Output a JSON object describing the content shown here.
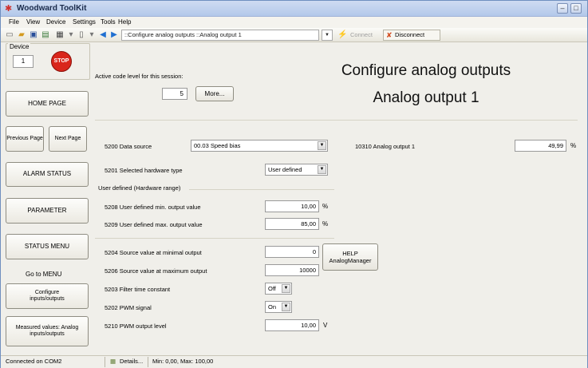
{
  "window": {
    "title": "Woodward ToolKit"
  },
  "menubar": {
    "items": [
      "File",
      "View",
      "Device",
      "Settings",
      "Tools",
      "Help"
    ]
  },
  "toolbar": {
    "page_field": "::Configure analog outputs ::Analog output 1",
    "connect_label": "Connect",
    "disconnect_label": "Disconnect"
  },
  "sidebar": {
    "device_label": "Device",
    "device_number": "1",
    "stop_label": "STOP",
    "home_page": "HOME PAGE",
    "previous_page": "Previous Page",
    "next_page": "Next Page",
    "alarm_status": "ALARM STATUS",
    "parameter": "PARAMETER",
    "status_menu": "STATUS MENU",
    "go_to_menu": "Go to MENU",
    "configure_io": "Configure inputs/outputs",
    "measured_values": "Measured values: Analog inputs/outputs"
  },
  "main": {
    "code_level_label": "Active code level for this session:",
    "code_level_value": "5",
    "more_button": "More...",
    "title_line1": "Configure analog outputs",
    "title_line2": "Analog output 1",
    "data_source_label": "5200 Data source",
    "data_source_value": "00.03 Speed bias",
    "hardware_type_label": "5201 Selected hardware type",
    "hardware_type_value": "User defined",
    "user_defined_group": "User defined (Hardware range)",
    "min_output_label": "5208 User defined min. output value",
    "min_output_value": "10,00",
    "min_output_unit": "%",
    "max_output_label": "5209 User defined max. output value",
    "max_output_value": "85,00",
    "max_output_unit": "%",
    "source_min_label": "5204 Source value at minimal output",
    "source_min_value": "0",
    "source_max_label": "5206 Source value at maximum output",
    "source_max_value": "10000",
    "filter_label": "5203 Filter time constant",
    "filter_value": "Off",
    "pwm_signal_label": "5202 PWM signal",
    "pwm_signal_value": "On",
    "pwm_level_label": "5210 PWM output level",
    "pwm_level_value": "10,00",
    "pwm_level_unit": "V",
    "help_button": "HELP AnalogManager",
    "analog_output_label": "10310 Analog output 1",
    "analog_output_value": "49,99",
    "analog_output_unit": "%"
  },
  "statusbar": {
    "connection": "Connected on COM2",
    "details": "Details...",
    "range": "Min: 0,00, Max: 100,00"
  }
}
